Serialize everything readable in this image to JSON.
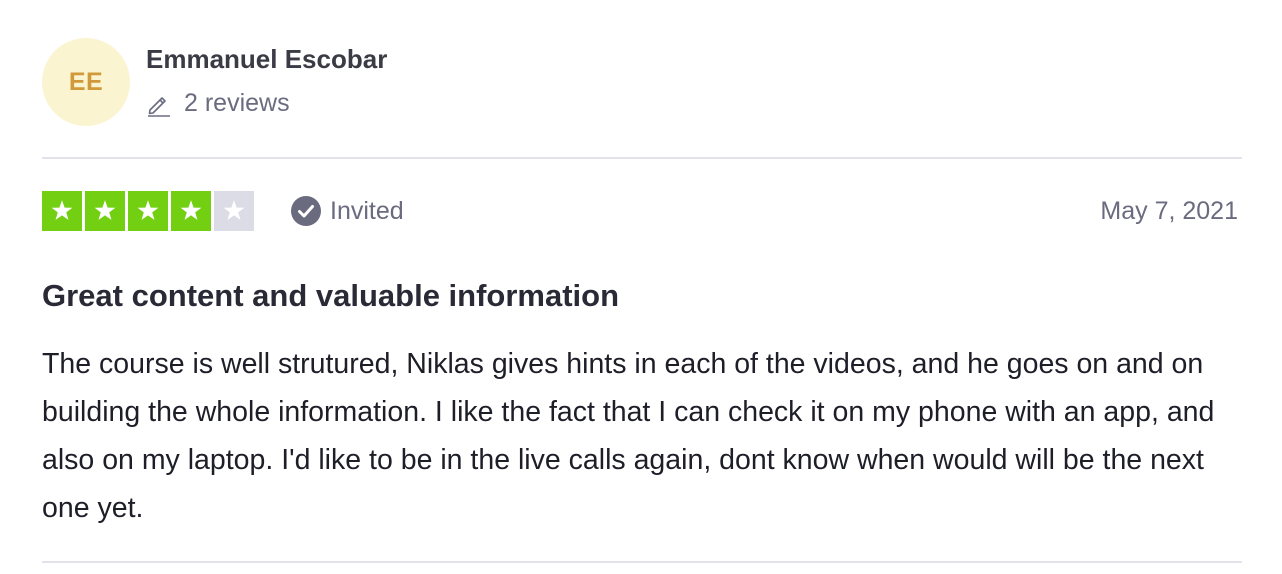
{
  "consumer": {
    "initials": "EE",
    "name": "Emmanuel Escobar",
    "reviews_label": "2 reviews"
  },
  "review": {
    "rating": 4,
    "max_rating": 5,
    "verification_label": "Invited",
    "date": "May 7, 2021",
    "title": "Great content and valuable information",
    "text": "The course is well strutured, Niklas gives hints in each of the videos, and he goes on and on building the whole information. I like the fact that I can check it on my phone with an app, and also on my laptop. I'd like to be in the live calls again, dont know when would will be the next one yet."
  },
  "colors": {
    "star_filled": "#73cf11",
    "star_empty": "#dcdce6",
    "avatar_bg": "#fbf4d0",
    "avatar_text": "#d09a3a",
    "muted_text": "#6b6b80"
  },
  "icons": {
    "reviews": "pencil-icon",
    "verification": "check-circle-icon",
    "star": "star-icon"
  }
}
